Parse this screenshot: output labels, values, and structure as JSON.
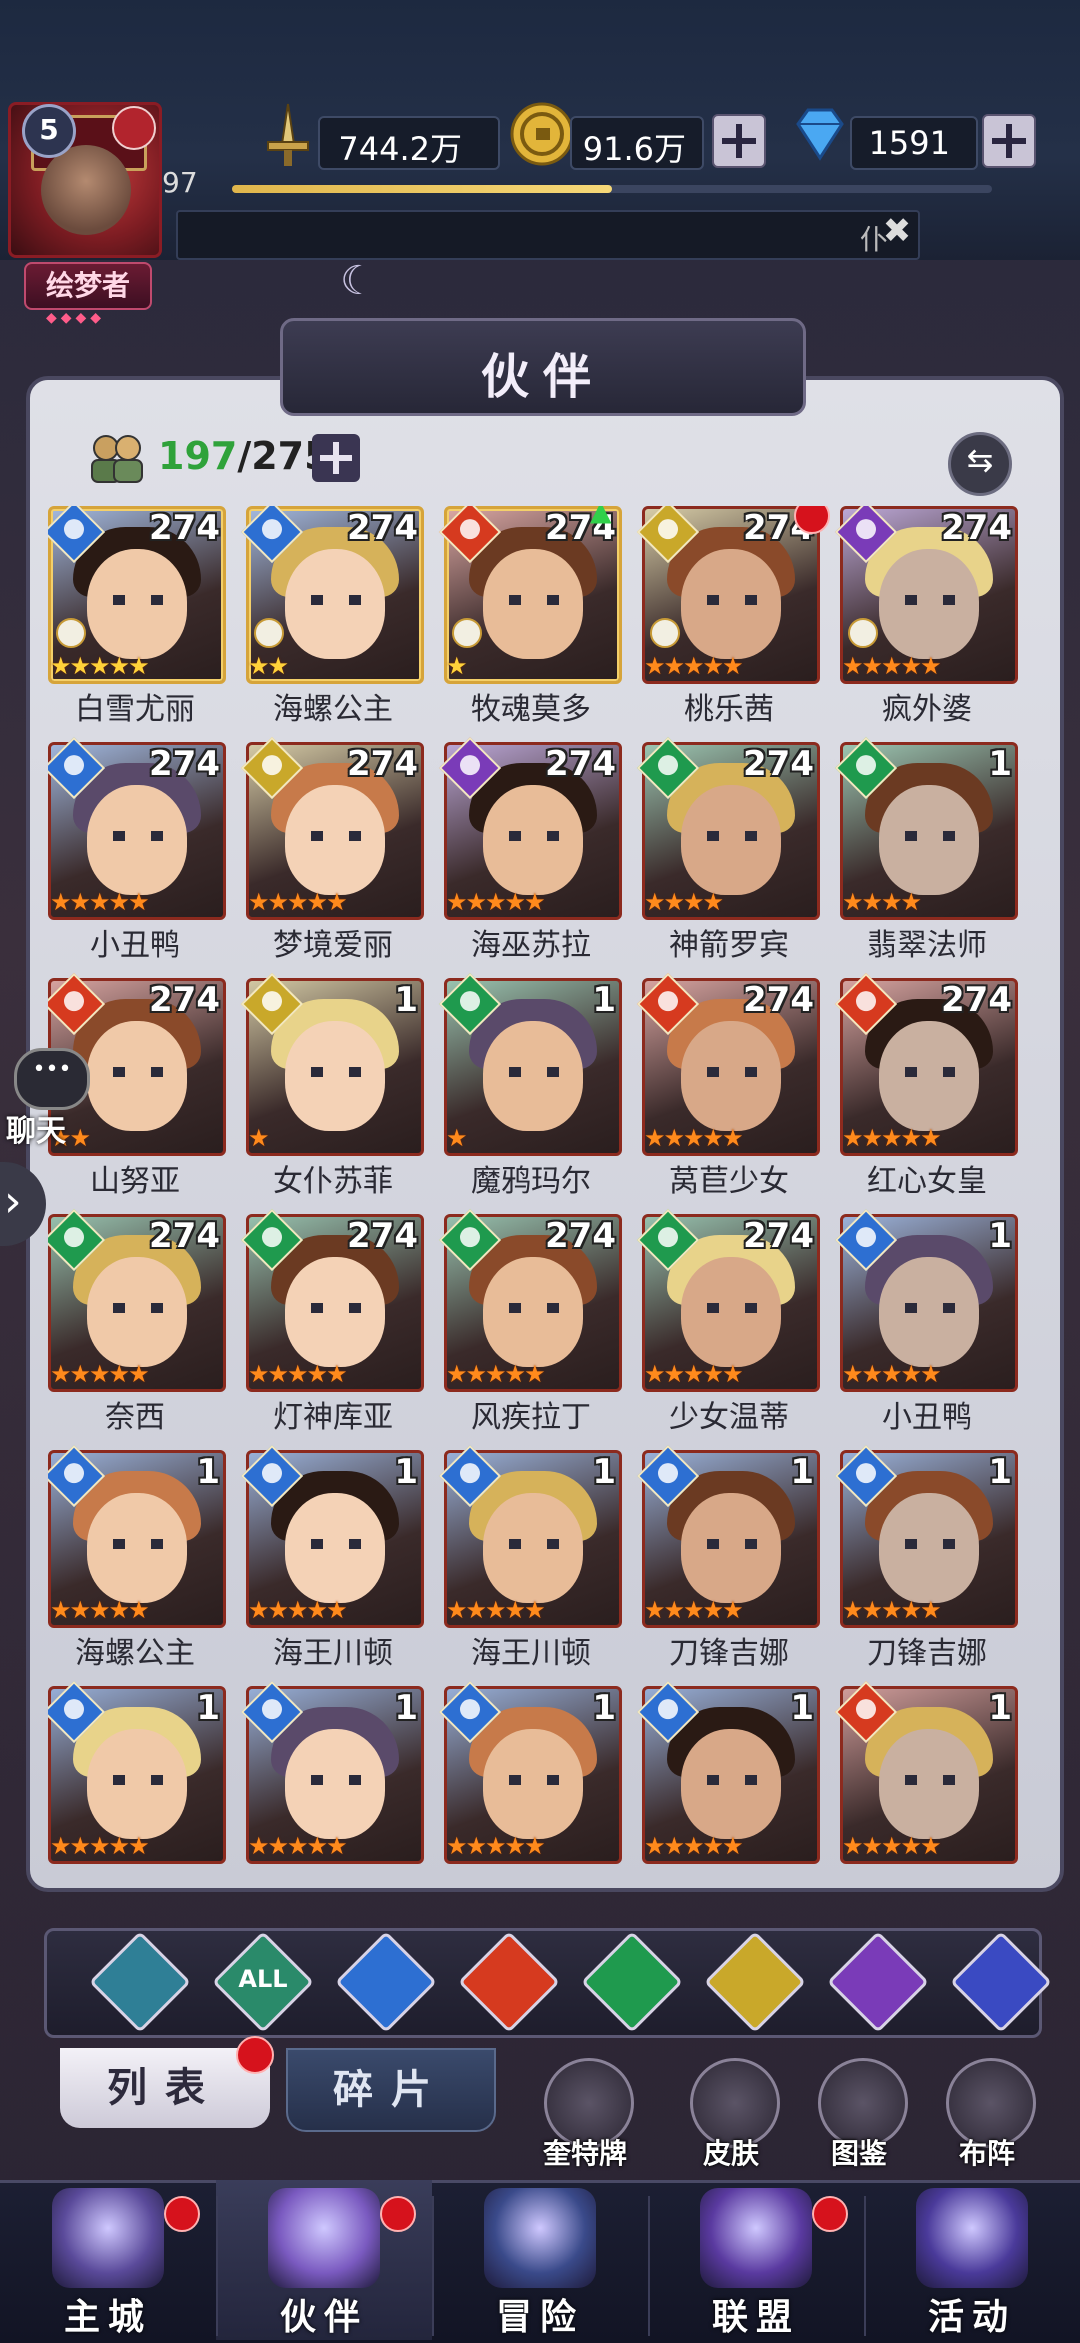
{
  "player": {
    "level": "5",
    "exp": "97",
    "exp_ratio": 0.5,
    "title": "绘梦者",
    "title_dots": "◆◆◆◆"
  },
  "resources": {
    "power": "744.2万",
    "gold": "91.6万",
    "diamond": "1591"
  },
  "notice": {
    "text": "仆",
    "close_icon": "close-x-icon"
  },
  "panel": {
    "title": "伙伴"
  },
  "hero_count": {
    "owned": "197",
    "total": "/275"
  },
  "sort_icon": "⇆",
  "heroes": [
    {
      "name": "白雪尤丽",
      "level": "274",
      "element": "water",
      "stars": "★★★★★",
      "star_color": "gold",
      "gold_frame": true,
      "rank": true
    },
    {
      "name": "海螺公主",
      "level": "274",
      "element": "water",
      "stars": "★★",
      "star_color": "gold",
      "gold_frame": true,
      "rank": true
    },
    {
      "name": "牧魂莫多",
      "level": "274",
      "element": "fire",
      "stars": "★",
      "star_color": "gold",
      "gold_frame": true,
      "rank": true,
      "up": true
    },
    {
      "name": "桃乐茜",
      "level": "274",
      "element": "light",
      "stars": "★★★★★",
      "star_color": "orange",
      "gold_frame": false,
      "rank": true,
      "reddot": true
    },
    {
      "name": "疯外婆",
      "level": "274",
      "element": "dark",
      "stars": "★★★★★",
      "star_color": "orange",
      "gold_frame": false,
      "rank": true
    },
    {
      "name": "小丑鸭",
      "level": "274",
      "element": "water",
      "stars": "★★★★★",
      "star_color": "orange",
      "gold_frame": false
    },
    {
      "name": "梦境爱丽",
      "level": "274",
      "element": "light",
      "stars": "★★★★★",
      "star_color": "orange",
      "gold_frame": false
    },
    {
      "name": "海巫苏拉",
      "level": "274",
      "element": "dark",
      "stars": "★★★★★",
      "star_color": "orange",
      "gold_frame": false
    },
    {
      "name": "神箭罗宾",
      "level": "274",
      "element": "wind",
      "stars": "★★★★",
      "star_color": "orange",
      "gold_frame": false
    },
    {
      "name": "翡翠法师",
      "level": "1",
      "element": "wind",
      "stars": "★★★★",
      "star_color": "orange",
      "gold_frame": false
    },
    {
      "name": "山努亚",
      "level": "274",
      "element": "fire",
      "stars": "★★",
      "star_color": "orange",
      "gold_frame": false
    },
    {
      "name": "女仆苏菲",
      "level": "1",
      "element": "light",
      "stars": "★",
      "star_color": "orange",
      "gold_frame": false
    },
    {
      "name": "魔鸦玛尔",
      "level": "1",
      "element": "wind",
      "stars": "★",
      "star_color": "orange",
      "gold_frame": false
    },
    {
      "name": "莴苣少女",
      "level": "274",
      "element": "fire",
      "stars": "★★★★★",
      "star_color": "orange",
      "gold_frame": false
    },
    {
      "name": "红心女皇",
      "level": "274",
      "element": "fire",
      "stars": "★★★★★",
      "star_color": "orange",
      "gold_frame": false
    },
    {
      "name": "奈西",
      "level": "274",
      "element": "wind",
      "stars": "★★★★★",
      "star_color": "orange",
      "gold_frame": false
    },
    {
      "name": "灯神库亚",
      "level": "274",
      "element": "wind",
      "stars": "★★★★★",
      "star_color": "orange",
      "gold_frame": false
    },
    {
      "name": "风疾拉丁",
      "level": "274",
      "element": "wind",
      "stars": "★★★★★",
      "star_color": "orange",
      "gold_frame": false
    },
    {
      "name": "少女温蒂",
      "level": "274",
      "element": "wind",
      "stars": "★★★★★",
      "star_color": "orange",
      "gold_frame": false
    },
    {
      "name": "小丑鸭",
      "level": "1",
      "element": "water",
      "stars": "★★★★★",
      "star_color": "orange",
      "gold_frame": false
    },
    {
      "name": "海螺公主",
      "level": "1",
      "element": "water",
      "stars": "★★★★★",
      "star_color": "orange",
      "gold_frame": false
    },
    {
      "name": "海王川顿",
      "level": "1",
      "element": "water",
      "stars": "★★★★★",
      "star_color": "orange",
      "gold_frame": false
    },
    {
      "name": "海王川顿",
      "level": "1",
      "element": "water",
      "stars": "★★★★★",
      "star_color": "orange",
      "gold_frame": false
    },
    {
      "name": "刀锋吉娜",
      "level": "1",
      "element": "water",
      "stars": "★★★★★",
      "star_color": "orange",
      "gold_frame": false
    },
    {
      "name": "刀锋吉娜",
      "level": "1",
      "element": "water",
      "stars": "★★★★★",
      "star_color": "orange",
      "gold_frame": false
    },
    {
      "name": "",
      "level": "1",
      "element": "water",
      "stars": "★★★★★",
      "star_color": "orange",
      "gold_frame": false
    },
    {
      "name": "",
      "level": "1",
      "element": "water",
      "stars": "★★★★★",
      "star_color": "orange",
      "gold_frame": false
    },
    {
      "name": "",
      "level": "1",
      "element": "water",
      "stars": "★★★★★",
      "star_color": "orange",
      "gold_frame": false
    },
    {
      "name": "",
      "level": "1",
      "element": "water",
      "stars": "★★★★★",
      "star_color": "orange",
      "gold_frame": false
    },
    {
      "name": "",
      "level": "1",
      "element": "fire",
      "stars": "★★★★★",
      "star_color": "orange",
      "gold_frame": false
    }
  ],
  "element_colors": {
    "water": "#2d6fd2",
    "fire": "#d63a1f",
    "wind": "#1f9a4e",
    "light": "#c9a82a",
    "dark": "#7a3bb8",
    "space": "#3a4ac2",
    "all": "#2a8a6a",
    "base": "#2f7f96"
  },
  "filters": [
    {
      "key": "base",
      "label": "",
      "icon": "diamond-icon"
    },
    {
      "key": "all",
      "label": "ALL",
      "icon": "all-icon"
    },
    {
      "key": "water",
      "label": "",
      "icon": "water-drop-icon"
    },
    {
      "key": "fire",
      "label": "",
      "icon": "fire-icon"
    },
    {
      "key": "wind",
      "label": "",
      "icon": "wind-icon"
    },
    {
      "key": "light",
      "label": "",
      "icon": "light-star-icon"
    },
    {
      "key": "dark",
      "label": "",
      "icon": "moon-icon"
    },
    {
      "key": "space",
      "label": "",
      "icon": "planet-icon"
    }
  ],
  "tabs": {
    "list": "列表",
    "shards": "碎片"
  },
  "tools": [
    {
      "label": "奎特牌"
    },
    {
      "label": "皮肤"
    },
    {
      "label": "图鉴"
    },
    {
      "label": "布阵"
    }
  ],
  "chat": {
    "label": "聊天"
  },
  "nav": [
    {
      "label": "主城",
      "dot": true
    },
    {
      "label": "伙伴",
      "dot": true,
      "active": true
    },
    {
      "label": "冒险",
      "dot": false
    },
    {
      "label": "联盟",
      "dot": true
    },
    {
      "label": "活动",
      "dot": false
    }
  ]
}
